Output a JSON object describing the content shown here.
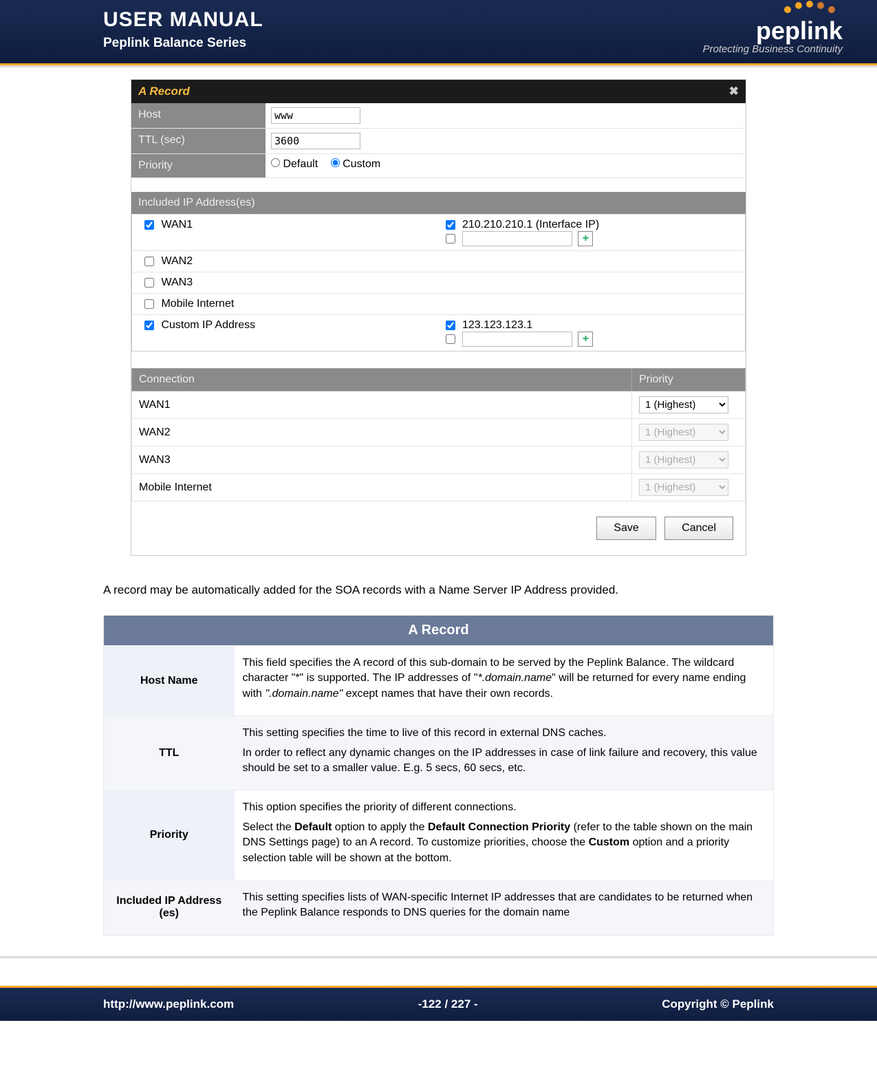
{
  "header": {
    "title": "USER MANUAL",
    "subtitle": "Peplink Balance Series",
    "brand": "peplink",
    "tagline": "Protecting Business Continuity"
  },
  "dialog": {
    "title": "A Record",
    "rows": {
      "host_label": "Host",
      "host_value": "www",
      "ttl_label": "TTL (sec)",
      "ttl_value": "3600",
      "priority_label": "Priority",
      "radio_default": "Default",
      "radio_custom": "Custom"
    },
    "ip_section_header": "Included IP Address(es)",
    "ip_rows": [
      {
        "name": "WAN1",
        "checked": true,
        "ips": [
          {
            "text": "210.210.210.1 (Interface IP)",
            "checked": true
          },
          {
            "text": "",
            "checked": false,
            "input": true
          }
        ]
      },
      {
        "name": "WAN2",
        "checked": false
      },
      {
        "name": "WAN3",
        "checked": false
      },
      {
        "name": "Mobile Internet",
        "checked": false
      },
      {
        "name": "Custom IP Address",
        "checked": true,
        "ips": [
          {
            "text": "123.123.123.1",
            "checked": true
          },
          {
            "text": "",
            "checked": false,
            "input": true
          }
        ]
      }
    ],
    "prio_header_conn": "Connection",
    "prio_header_prio": "Priority",
    "prio_rows": [
      {
        "conn": "WAN1",
        "val": "1 (Highest)",
        "enabled": true
      },
      {
        "conn": "WAN2",
        "val": "1 (Highest)",
        "enabled": false
      },
      {
        "conn": "WAN3",
        "val": "1 (Highest)",
        "enabled": false
      },
      {
        "conn": "Mobile Internet",
        "val": "1 (Highest)",
        "enabled": false
      }
    ],
    "save": "Save",
    "cancel": "Cancel"
  },
  "paragraph": "A record may be automatically added for the SOA records with a Name Server IP Address provided.",
  "info": {
    "title": "A Record",
    "rows": [
      {
        "label": "Host Name",
        "html": "This field specifies the A record of this sub-domain to be served by the Peplink Balance. The wildcard character \"*\" is supported. The IP addresses of \"*.domain.name\" will be returned for every name ending with \".domain.name\" except names that have their own records."
      },
      {
        "label": "TTL",
        "html": "This setting specifies the time to live of this record in external DNS caches.\nIn order to reflect any dynamic changes on the IP addresses in case of link failure and recovery, this value should be set to a smaller value.  E.g. 5 secs, 60 secs, etc."
      },
      {
        "label": "Priority",
        "html": "This option specifies the priority of different connections.\nSelect the Default option to apply the Default Connection Priority (refer to the table shown on the main DNS Settings page) to an A record. To customize priorities, choose the Custom option and a priority selection table will be shown at the bottom."
      },
      {
        "label": "Included IP Address (es)",
        "html": "This setting specifies lists of WAN-specific Internet IP addresses that are candidates to be returned when the Peplink Balance responds to DNS queries for the domain name"
      }
    ]
  },
  "footer": {
    "url": "http://www.peplink.com",
    "page": "-122 / 227 -",
    "copy": "Copyright ©  Peplink"
  }
}
